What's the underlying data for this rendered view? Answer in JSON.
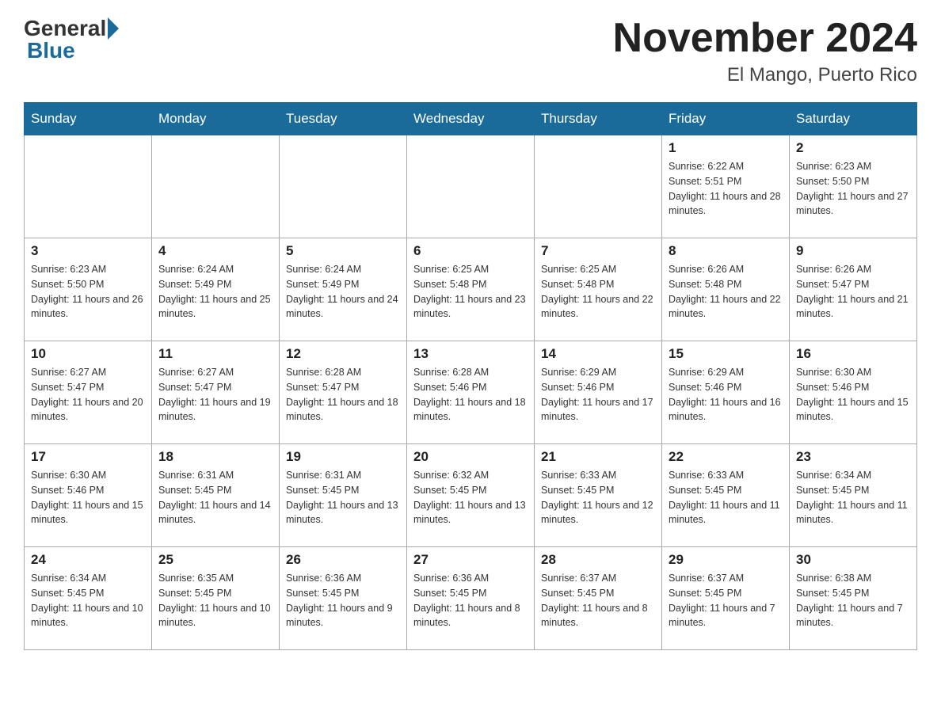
{
  "header": {
    "logo_general": "General",
    "logo_blue": "Blue",
    "month_title": "November 2024",
    "location": "El Mango, Puerto Rico"
  },
  "days_of_week": [
    "Sunday",
    "Monday",
    "Tuesday",
    "Wednesday",
    "Thursday",
    "Friday",
    "Saturday"
  ],
  "weeks": [
    [
      {
        "day": "",
        "info": ""
      },
      {
        "day": "",
        "info": ""
      },
      {
        "day": "",
        "info": ""
      },
      {
        "day": "",
        "info": ""
      },
      {
        "day": "",
        "info": ""
      },
      {
        "day": "1",
        "info": "Sunrise: 6:22 AM\nSunset: 5:51 PM\nDaylight: 11 hours and 28 minutes."
      },
      {
        "day": "2",
        "info": "Sunrise: 6:23 AM\nSunset: 5:50 PM\nDaylight: 11 hours and 27 minutes."
      }
    ],
    [
      {
        "day": "3",
        "info": "Sunrise: 6:23 AM\nSunset: 5:50 PM\nDaylight: 11 hours and 26 minutes."
      },
      {
        "day": "4",
        "info": "Sunrise: 6:24 AM\nSunset: 5:49 PM\nDaylight: 11 hours and 25 minutes."
      },
      {
        "day": "5",
        "info": "Sunrise: 6:24 AM\nSunset: 5:49 PM\nDaylight: 11 hours and 24 minutes."
      },
      {
        "day": "6",
        "info": "Sunrise: 6:25 AM\nSunset: 5:48 PM\nDaylight: 11 hours and 23 minutes."
      },
      {
        "day": "7",
        "info": "Sunrise: 6:25 AM\nSunset: 5:48 PM\nDaylight: 11 hours and 22 minutes."
      },
      {
        "day": "8",
        "info": "Sunrise: 6:26 AM\nSunset: 5:48 PM\nDaylight: 11 hours and 22 minutes."
      },
      {
        "day": "9",
        "info": "Sunrise: 6:26 AM\nSunset: 5:47 PM\nDaylight: 11 hours and 21 minutes."
      }
    ],
    [
      {
        "day": "10",
        "info": "Sunrise: 6:27 AM\nSunset: 5:47 PM\nDaylight: 11 hours and 20 minutes."
      },
      {
        "day": "11",
        "info": "Sunrise: 6:27 AM\nSunset: 5:47 PM\nDaylight: 11 hours and 19 minutes."
      },
      {
        "day": "12",
        "info": "Sunrise: 6:28 AM\nSunset: 5:47 PM\nDaylight: 11 hours and 18 minutes."
      },
      {
        "day": "13",
        "info": "Sunrise: 6:28 AM\nSunset: 5:46 PM\nDaylight: 11 hours and 18 minutes."
      },
      {
        "day": "14",
        "info": "Sunrise: 6:29 AM\nSunset: 5:46 PM\nDaylight: 11 hours and 17 minutes."
      },
      {
        "day": "15",
        "info": "Sunrise: 6:29 AM\nSunset: 5:46 PM\nDaylight: 11 hours and 16 minutes."
      },
      {
        "day": "16",
        "info": "Sunrise: 6:30 AM\nSunset: 5:46 PM\nDaylight: 11 hours and 15 minutes."
      }
    ],
    [
      {
        "day": "17",
        "info": "Sunrise: 6:30 AM\nSunset: 5:46 PM\nDaylight: 11 hours and 15 minutes."
      },
      {
        "day": "18",
        "info": "Sunrise: 6:31 AM\nSunset: 5:45 PM\nDaylight: 11 hours and 14 minutes."
      },
      {
        "day": "19",
        "info": "Sunrise: 6:31 AM\nSunset: 5:45 PM\nDaylight: 11 hours and 13 minutes."
      },
      {
        "day": "20",
        "info": "Sunrise: 6:32 AM\nSunset: 5:45 PM\nDaylight: 11 hours and 13 minutes."
      },
      {
        "day": "21",
        "info": "Sunrise: 6:33 AM\nSunset: 5:45 PM\nDaylight: 11 hours and 12 minutes."
      },
      {
        "day": "22",
        "info": "Sunrise: 6:33 AM\nSunset: 5:45 PM\nDaylight: 11 hours and 11 minutes."
      },
      {
        "day": "23",
        "info": "Sunrise: 6:34 AM\nSunset: 5:45 PM\nDaylight: 11 hours and 11 minutes."
      }
    ],
    [
      {
        "day": "24",
        "info": "Sunrise: 6:34 AM\nSunset: 5:45 PM\nDaylight: 11 hours and 10 minutes."
      },
      {
        "day": "25",
        "info": "Sunrise: 6:35 AM\nSunset: 5:45 PM\nDaylight: 11 hours and 10 minutes."
      },
      {
        "day": "26",
        "info": "Sunrise: 6:36 AM\nSunset: 5:45 PM\nDaylight: 11 hours and 9 minutes."
      },
      {
        "day": "27",
        "info": "Sunrise: 6:36 AM\nSunset: 5:45 PM\nDaylight: 11 hours and 8 minutes."
      },
      {
        "day": "28",
        "info": "Sunrise: 6:37 AM\nSunset: 5:45 PM\nDaylight: 11 hours and 8 minutes."
      },
      {
        "day": "29",
        "info": "Sunrise: 6:37 AM\nSunset: 5:45 PM\nDaylight: 11 hours and 7 minutes."
      },
      {
        "day": "30",
        "info": "Sunrise: 6:38 AM\nSunset: 5:45 PM\nDaylight: 11 hours and 7 minutes."
      }
    ]
  ]
}
